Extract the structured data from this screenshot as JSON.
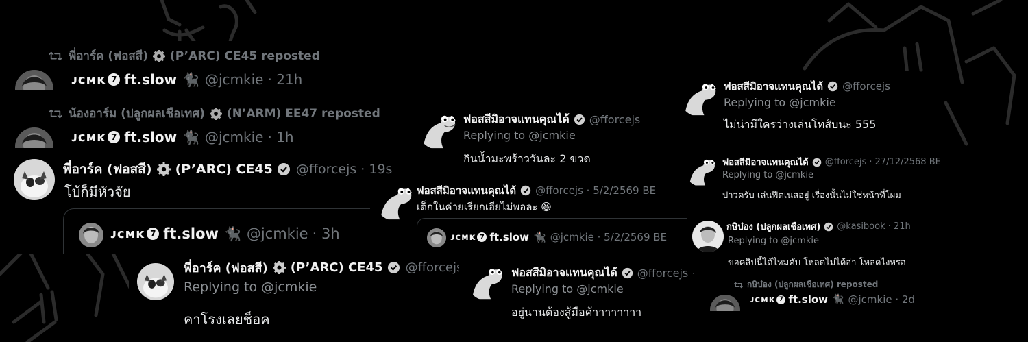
{
  "colors": {
    "background": "#000000",
    "text": "#e7e9ea",
    "muted": "#71767b",
    "verified": "#d0d0d0"
  },
  "repost1": {
    "label": "พี่อาร์ค (ฟอสสี)",
    "tail": "(P’ARC) CE45 reposted"
  },
  "post1": {
    "name": "ᴊᴄᴍᴋ",
    "name2": "ft.slow",
    "handle": "@jcmkie",
    "time": "· 21h"
  },
  "repost2": {
    "label": "น้องอาร์ม (ปลูกผลเชือเทศ)",
    "tail": "(N’ARM) EE47 reposted"
  },
  "post2": {
    "name": "ᴊᴄᴍᴋ",
    "name2": "ft.slow",
    "handle": "@jcmkie",
    "time": "· 1h"
  },
  "quote_tweet": {
    "name": "พี่อาร์ค (ฟอสสี)",
    "name2": "(P’ARC) CE45",
    "handle": "@fforcejs",
    "time": "· 19s",
    "text": "โบ้ก็มีหัวจัย",
    "quoted": {
      "name": "ᴊᴄᴍᴋ",
      "name2": "ft.slow",
      "handle": "@jcmkie",
      "time": "· 3h"
    }
  },
  "reply_arc": {
    "name": "พี่อาร์ค (ฟอสสี)",
    "name2": "(P’ARC) CE45",
    "handle": "@fforcejs ·",
    "replying": "Replying to @jcmkie",
    "text": "คาโรงเลยช็อค"
  },
  "reply_coconut": {
    "name": "ฟอสสีมิอาจแทนคุณได้",
    "handle": "@fforcejs",
    "replying": "Replying to @jcmkie",
    "text": "กินน้ำมะพร้าววันละ 2 ขวด"
  },
  "reply_camp": {
    "name": "ฟอสสีมิอาจแทนคุณได้",
    "handle": "@fforcejs · 5/2/2569 BE",
    "text": "เด็กในค่ายเรียกเฮียไม่พอละ 😆",
    "quoted": {
      "name": "ᴊᴄᴍᴋ",
      "name2": "ft.slow",
      "handle": "@jcmkie · 5/2/2569 BE"
    }
  },
  "reply_live": {
    "name": "ฟอสสีมิอาจแทนคุณได้",
    "handle": "@fforcejs ·",
    "replying": "Replying to @jcmkie",
    "text": "อยู่นานต้องสู้มือค้าาาาาาาา"
  },
  "reply_phone": {
    "name": "ฟอสสีมิอาจแทนคุณได้",
    "handle": "@fforcejs",
    "replying": "Replying to @jcmkie",
    "text": "ไม่น่ามีใครว่างเล่นโทสับนะ 555"
  },
  "reply_fitness": {
    "name": "ฟอสสีมิอาจแทนคุณได้",
    "handle": "@fforcejs · 27/12/2568 BE",
    "replying": "Replying to @jcmkie",
    "text": "ป่าวครับ เล่นฟิตเนสอยู่ เรื่องนั้นไม่ใช่หน้าที่โผม"
  },
  "reply_kasi": {
    "name": "กษิบ๋อง (ปลูกผลเชือเทศ)",
    "handle": "@kasibook · 21h",
    "replying": "Replying to @jcmkie",
    "text": "ขอคลิปนี้ได้ไหมคับ โหลดไม่ได้อ่า โหลดไงหรอ"
  },
  "repost3": {
    "label": "กษิบ๋อง (ปลูกผลเชือเทศ) reposted"
  },
  "post3": {
    "name": "ᴊᴄᴍᴋ",
    "name2": "ft.slow",
    "handle": "@jcmkie · 2d"
  }
}
